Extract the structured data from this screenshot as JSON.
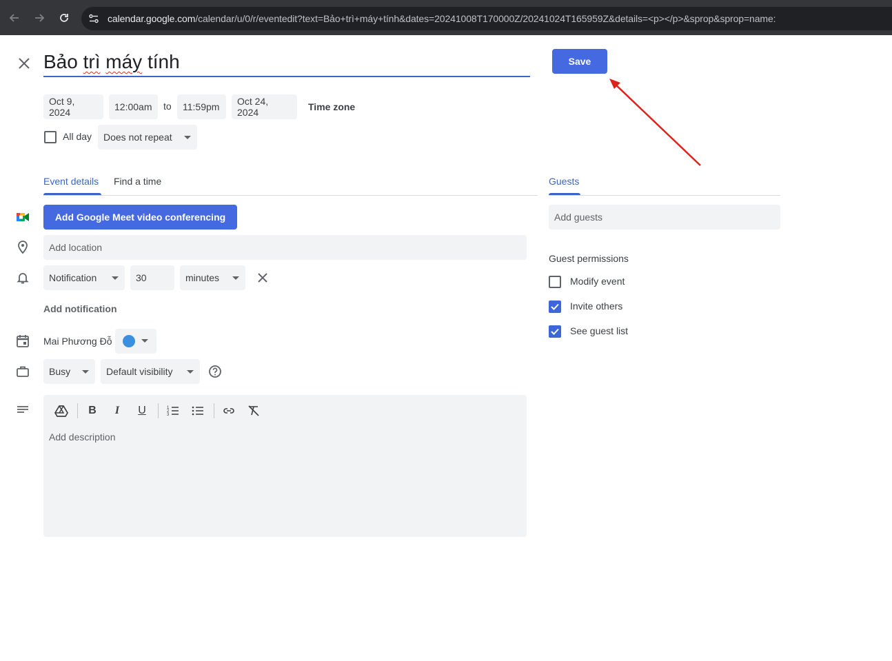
{
  "browser": {
    "url_host": "calendar.google.com",
    "url_path": "/calendar/u/0/r/eventedit?text=Bảo+trì+máy+tính&dates=20241008T170000Z/20241024T165959Z&details=<p></p>&sprop&sprop=name:"
  },
  "event": {
    "title_word1": "Bảo ",
    "title_word2": "trì",
    "title_space": " ",
    "title_word3": "máy",
    "title_word4": " tính",
    "start_date": "Oct 9, 2024",
    "start_time": "12:00am",
    "to_label": "to",
    "end_time": "11:59pm",
    "end_date": "Oct 24, 2024",
    "time_zone_label": "Time zone",
    "all_day_label": "All day",
    "all_day_checked": false,
    "repeat_value": "Does not repeat"
  },
  "actions": {
    "save_label": "Save",
    "close_icon": "close-icon"
  },
  "tabs": {
    "event_details": "Event details",
    "find_a_time": "Find a time",
    "guests": "Guests"
  },
  "details": {
    "meet_button": "Add Google Meet video conferencing",
    "location_placeholder": "Add location",
    "notification_type": "Notification",
    "notification_value": "30",
    "notification_unit": "minutes",
    "add_notification": "Add notification",
    "calendar_owner": "Mai Phương Đỗ",
    "calendar_color": "#3a8fe0",
    "busy_value": "Busy",
    "visibility_value": "Default visibility",
    "description_placeholder": "Add description"
  },
  "guests": {
    "add_placeholder": "Add guests",
    "permissions_title": "Guest permissions",
    "permissions": [
      {
        "label": "Modify event",
        "checked": false
      },
      {
        "label": "Invite others",
        "checked": true
      },
      {
        "label": "See guest list",
        "checked": true
      }
    ]
  },
  "colors": {
    "accent": "#4469e0",
    "annotation_arrow": "#e0201b"
  }
}
